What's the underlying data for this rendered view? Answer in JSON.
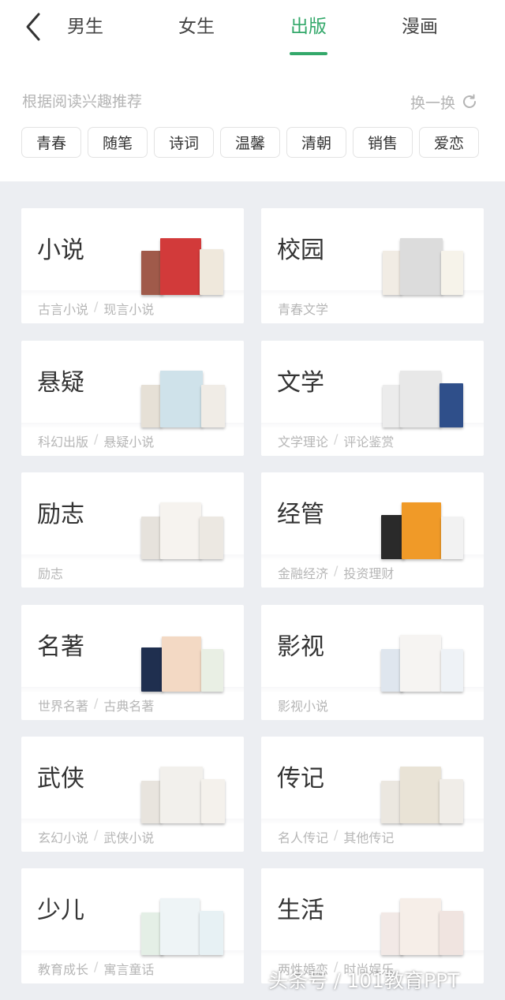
{
  "nav": {
    "tabs": [
      "男生",
      "女生",
      "出版",
      "漫画"
    ],
    "active_tab": "出版"
  },
  "recommend": {
    "label": "根据阅读兴趣推荐",
    "refresh_label": "换一换",
    "tags": [
      "青春",
      "随笔",
      "诗词",
      "温馨",
      "清朝",
      "销售",
      "爱恋"
    ]
  },
  "categories": [
    {
      "title": "小说",
      "subs": [
        "古言小说",
        "现言小说"
      ]
    },
    {
      "title": "校园",
      "subs": [
        "青春文学"
      ]
    },
    {
      "title": "悬疑",
      "subs": [
        "科幻出版",
        "悬疑小说"
      ]
    },
    {
      "title": "文学",
      "subs": [
        "文学理论",
        "评论鉴赏"
      ]
    },
    {
      "title": "励志",
      "subs": [
        "励志"
      ]
    },
    {
      "title": "经管",
      "subs": [
        "金融经济",
        "投资理财"
      ]
    },
    {
      "title": "名著",
      "subs": [
        "世界名著",
        "古典名著"
      ]
    },
    {
      "title": "影视",
      "subs": [
        "影视小说"
      ]
    },
    {
      "title": "武侠",
      "subs": [
        "玄幻小说",
        "武侠小说"
      ]
    },
    {
      "title": "传记",
      "subs": [
        "名人传记",
        "其他传记"
      ]
    },
    {
      "title": "少儿",
      "subs": [
        "教育成长",
        "寓言童话"
      ]
    },
    {
      "title": "生活",
      "subs": [
        "两性婚恋",
        "时尚娱乐"
      ]
    }
  ],
  "watermark": "头条号 / 101教育PPT",
  "colors": {
    "accent": "#33a86a",
    "background": "#eceef2"
  }
}
